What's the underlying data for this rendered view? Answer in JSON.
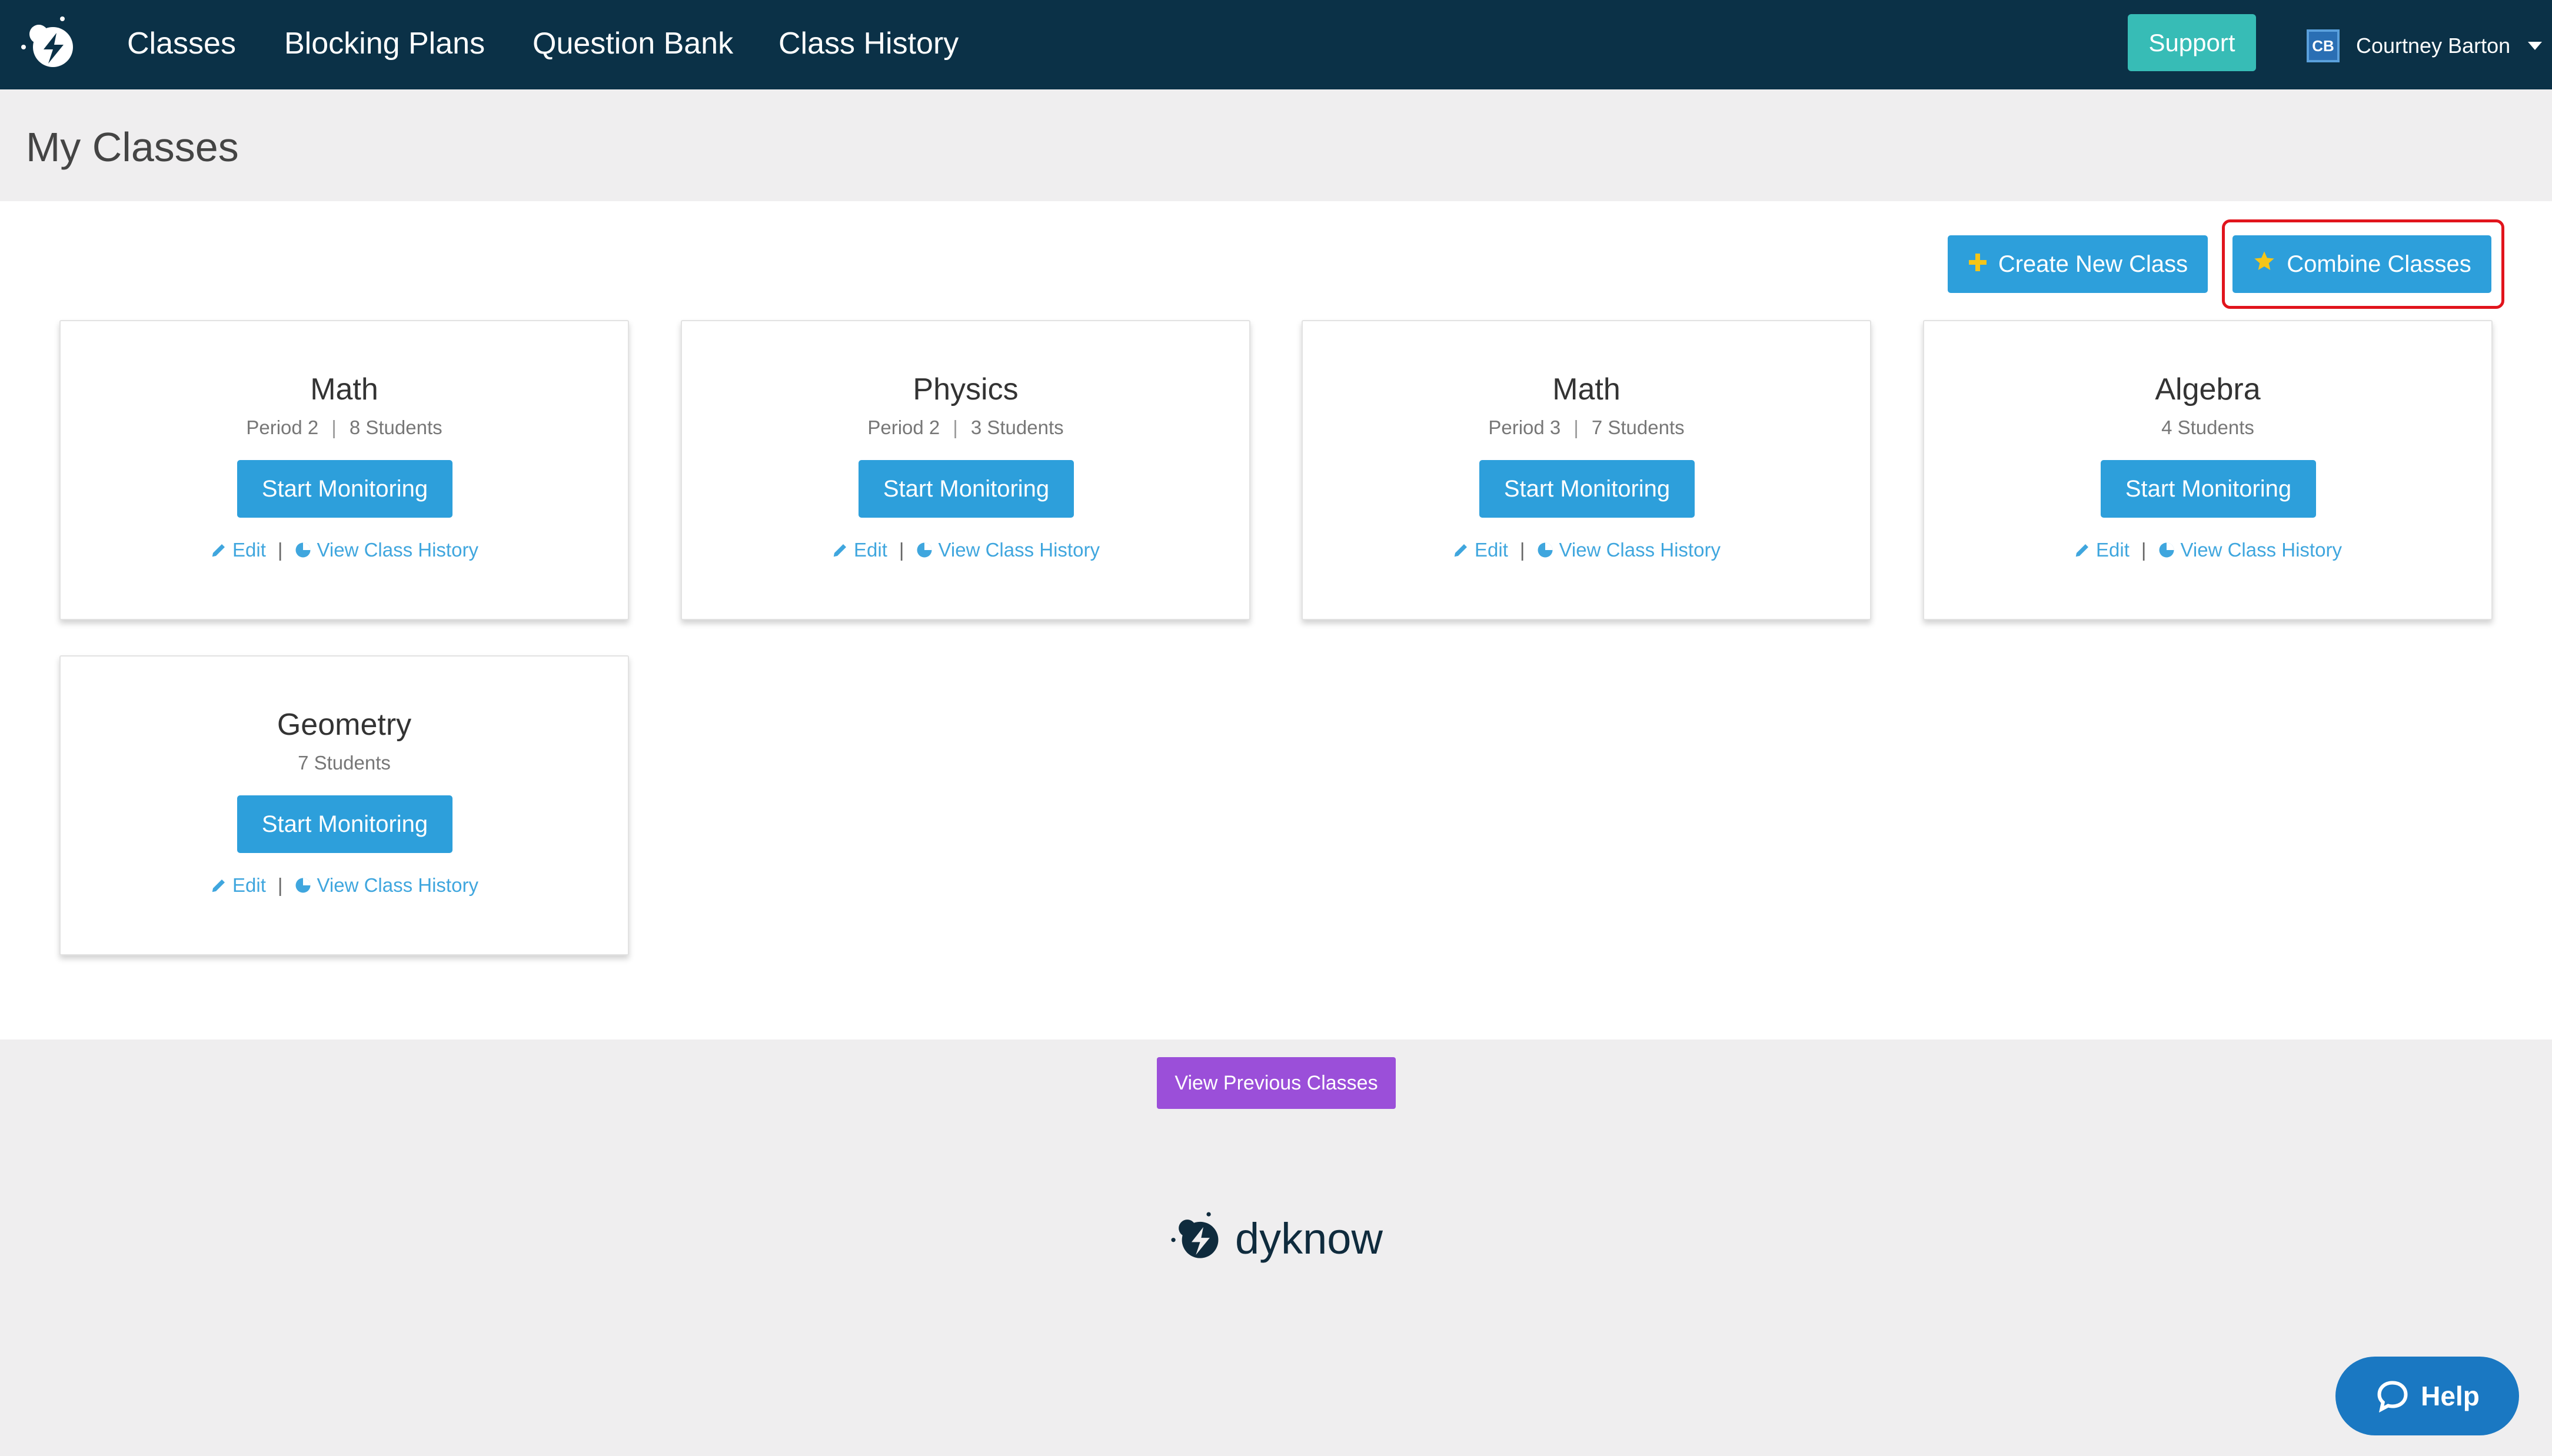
{
  "nav": {
    "items": [
      "Classes",
      "Blocking Plans",
      "Question Bank",
      "Class History"
    ],
    "support_label": "Support",
    "user": {
      "initials": "CB",
      "name": "Courtney Barton"
    }
  },
  "page": {
    "title": "My Classes"
  },
  "actions": {
    "create_label": "Create New Class",
    "combine_label": "Combine Classes"
  },
  "classes": [
    {
      "name": "Math",
      "period": "Period 2",
      "students": "8 Students",
      "button": "Start Monitoring",
      "edit": "Edit",
      "history": "View Class History"
    },
    {
      "name": "Physics",
      "period": "Period 2",
      "students": "3 Students",
      "button": "Start Monitoring",
      "edit": "Edit",
      "history": "View Class History"
    },
    {
      "name": "Math",
      "period": "Period 3",
      "students": "7 Students",
      "button": "Start Monitoring",
      "edit": "Edit",
      "history": "View Class History"
    },
    {
      "name": "Algebra",
      "period": "",
      "students": "4 Students",
      "button": "Start Monitoring",
      "edit": "Edit",
      "history": "View Class History"
    },
    {
      "name": "Geometry",
      "period": "",
      "students": "7 Students",
      "button": "Start Monitoring",
      "edit": "Edit",
      "history": "View Class History"
    }
  ],
  "footer": {
    "view_previous_label": "View Previous Classes",
    "brand": "dyknow",
    "help_label": "Help"
  },
  "colors": {
    "nav_bg": "#0b3147",
    "primary": "#2d9fdb",
    "support": "#37bcb6",
    "view_previous": "#9b4fd9",
    "highlight": "#e1141c",
    "help": "#1a78c2"
  }
}
